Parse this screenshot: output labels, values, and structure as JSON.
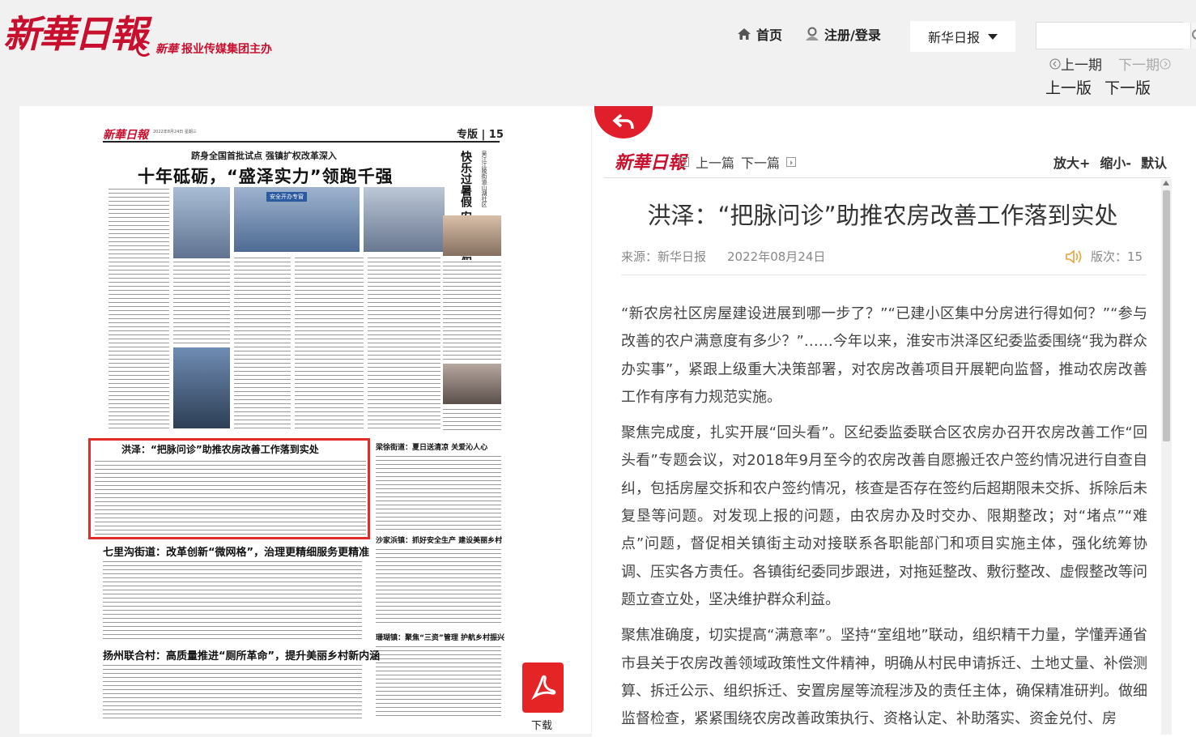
{
  "header": {
    "logo_text": "新華日報",
    "logo_sub": "报业传媒集团主办",
    "logo_sub_brand": "新華",
    "nav_home": "首页",
    "nav_login": "注册/登录",
    "paper_select": "新华日报",
    "search_placeholder": "",
    "prev_issue": "上一期",
    "next_issue": "下一期",
    "prev_page": "上一版",
    "next_page": "下一版"
  },
  "newspaper": {
    "logo": "新華日報",
    "date_line": "2022年8月24日 星期三",
    "page_label": "专版 | 15",
    "kicker": "跻身全国首批试点 强镇扩权改革深入",
    "headline": "十年砥砺，“盛泽实力”领跑千强",
    "side_vertical": "快乐过暑假 安全不放假",
    "side_small": "吴江江陵街道山湖社区",
    "photo_banner": "安全开办专窗",
    "article_selected": "洪泽：“把脉问诊”助推农房改善工作落到实处",
    "article_2": "梁徐街道：夏日送清凉 关爱沁人心",
    "article_3": "七里沟街道：改革创新“微网格”，治理更精细服务更精准",
    "article_4": "沙家浜镇：抓好安全生产 建设美丽乡村",
    "article_5": "珊瑚镇：聚焦“三资”管理 护航乡村振兴",
    "article_6": "扬州联合村：高质量推进“厕所革命”，提升美丽乡村新内涵",
    "download_label": "下载"
  },
  "article": {
    "logo": "新華日報",
    "prev_article": "上一篇",
    "next_article": "下一篇",
    "zoom_in": "放大+",
    "zoom_out": "缩小-",
    "zoom_default": "默认",
    "title": "洪泽：“把脉问诊”助推农房改善工作落到实处",
    "source": "来源：新华日报",
    "date": "2022年08月24日",
    "page_no": "版次：15",
    "paragraphs": [
      "“新农房社区房屋建设进展到哪一步了？”“已建小区集中分房进行得如何？”“参与改善的农户满意度有多少？”……今年以来，淮安市洪泽区纪委监委围绕“我为群众办实事”，紧跟上级重大决策部署，对农房改善项目开展靶向监督，推动农房改善工作有序有力规范实施。",
      "聚焦完成度，扎实开展“回头看”。区纪委监委联合区农房办召开农房改善工作“回头看”专题会议，对2018年9月至今的农房改善自愿搬迁农户签约情况进行自查自纠，包括房屋交拆和农户签约情况，核查是否存在签约后超期限未交拆、拆除后未复垦等问题。对发现上报的问题，由农房办及时交办、限期整改；对“堵点”“难点”问题，督促相关镇街主动对接联系各职能部门和项目实施主体，强化统筹协调、压实各方责任。各镇街纪委同步跟进，对拖延整改、敷衍整改、虚假整改等问题立查立处，坚决维护群众利益。",
      "聚焦准确度，切实提高“满意率”。坚持“室组地”联动，组织精干力量，学懂弄通省市县关于农房改善领域政策性文件精神，明确从村民申请拆迁、土地丈量、补偿测算、拆迁公示、组织拆迁、安置房屋等流程涉及的责任主体，确保精准研判。做细监督检查，紧紧围绕农房改善政策执行、资格认定、补助落实、资金兑付、房"
    ]
  },
  "colors": {
    "brand_red": "#c8102e",
    "highlight_red": "#e12c2c"
  }
}
